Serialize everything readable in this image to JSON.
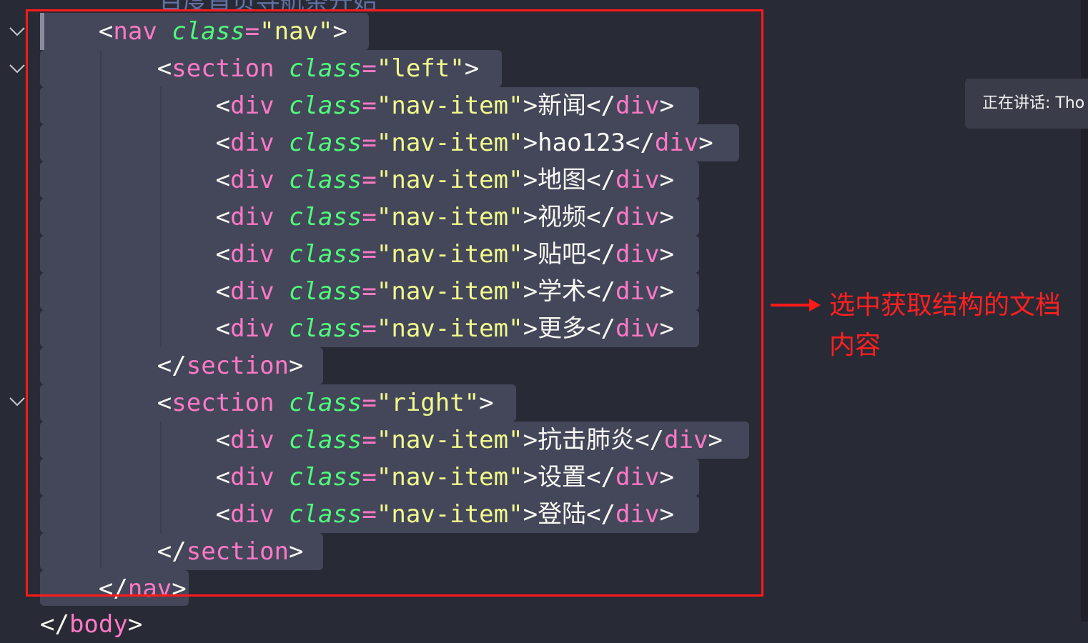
{
  "editor": {
    "top_partial_comment": "    百度首页导航条开始",
    "lines": [
      {
        "indent": "    ",
        "open": "<",
        "tag": "nav",
        "attr": "class",
        "eq": "=",
        "val": "\"nav\"",
        "close": ">",
        "text": "",
        "end_open": "",
        "end_tag": "",
        "end_close": ""
      },
      {
        "indent": "        ",
        "open": "<",
        "tag": "section",
        "attr": "class",
        "eq": "=",
        "val": "\"left\"",
        "close": ">",
        "text": "",
        "end_open": "",
        "end_tag": "",
        "end_close": ""
      },
      {
        "indent": "            ",
        "open": "<",
        "tag": "div",
        "attr": "class",
        "eq": "=",
        "val": "\"nav-item\"",
        "close": ">",
        "text": "新闻",
        "end_open": "</",
        "end_tag": "div",
        "end_close": ">"
      },
      {
        "indent": "            ",
        "open": "<",
        "tag": "div",
        "attr": "class",
        "eq": "=",
        "val": "\"nav-item\"",
        "close": ">",
        "text": "hao123",
        "end_open": "</",
        "end_tag": "div",
        "end_close": ">"
      },
      {
        "indent": "            ",
        "open": "<",
        "tag": "div",
        "attr": "class",
        "eq": "=",
        "val": "\"nav-item\"",
        "close": ">",
        "text": "地图",
        "end_open": "</",
        "end_tag": "div",
        "end_close": ">"
      },
      {
        "indent": "            ",
        "open": "<",
        "tag": "div",
        "attr": "class",
        "eq": "=",
        "val": "\"nav-item\"",
        "close": ">",
        "text": "视频",
        "end_open": "</",
        "end_tag": "div",
        "end_close": ">"
      },
      {
        "indent": "            ",
        "open": "<",
        "tag": "div",
        "attr": "class",
        "eq": "=",
        "val": "\"nav-item\"",
        "close": ">",
        "text": "贴吧",
        "end_open": "</",
        "end_tag": "div",
        "end_close": ">"
      },
      {
        "indent": "            ",
        "open": "<",
        "tag": "div",
        "attr": "class",
        "eq": "=",
        "val": "\"nav-item\"",
        "close": ">",
        "text": "学术",
        "end_open": "</",
        "end_tag": "div",
        "end_close": ">"
      },
      {
        "indent": "            ",
        "open": "<",
        "tag": "div",
        "attr": "class",
        "eq": "=",
        "val": "\"nav-item\"",
        "close": ">",
        "text": "更多",
        "end_open": "</",
        "end_tag": "div",
        "end_close": ">"
      },
      {
        "indent": "        ",
        "open": "</",
        "tag": "section",
        "attr": "",
        "eq": "",
        "val": "",
        "close": ">",
        "text": "",
        "end_open": "",
        "end_tag": "",
        "end_close": ""
      },
      {
        "indent": "        ",
        "open": "<",
        "tag": "section",
        "attr": "class",
        "eq": "=",
        "val": "\"right\"",
        "close": ">",
        "text": "",
        "end_open": "",
        "end_tag": "",
        "end_close": ""
      },
      {
        "indent": "            ",
        "open": "<",
        "tag": "div",
        "attr": "class",
        "eq": "=",
        "val": "\"nav-item\"",
        "close": ">",
        "text": "抗击肺炎",
        "end_open": "</",
        "end_tag": "div",
        "end_close": ">"
      },
      {
        "indent": "            ",
        "open": "<",
        "tag": "div",
        "attr": "class",
        "eq": "=",
        "val": "\"nav-item\"",
        "close": ">",
        "text": "设置",
        "end_open": "</",
        "end_tag": "div",
        "end_close": ">"
      },
      {
        "indent": "            ",
        "open": "<",
        "tag": "div",
        "attr": "class",
        "eq": "=",
        "val": "\"nav-item\"",
        "close": ">",
        "text": "登陆",
        "end_open": "</",
        "end_tag": "div",
        "end_close": ">"
      },
      {
        "indent": "        ",
        "open": "</",
        "tag": "section",
        "attr": "",
        "eq": "",
        "val": "",
        "close": ">",
        "text": "",
        "end_open": "",
        "end_tag": "",
        "end_close": ""
      },
      {
        "indent": "    ",
        "open": "</",
        "tag": "nav",
        "attr": "",
        "eq": "",
        "val": "",
        "close": ">",
        "text": "",
        "end_open": "",
        "end_tag": "",
        "end_close": ""
      }
    ],
    "bottom_partial": {
      "open": "</",
      "tag": "body",
      "close": ">"
    }
  },
  "annotation": {
    "text": "选中获取结构的文档内容",
    "color": "#ff2020"
  },
  "tooltip": {
    "text": "正在讲话: Tho"
  },
  "colors": {
    "background": "#282a36",
    "selection": "#44475a",
    "tag": "#ff79c6",
    "attr": "#50fa7b",
    "string": "#f1fa8c",
    "annotation_red": "#ff1a1a"
  },
  "icons": {
    "fold": "chevron-down-icon",
    "arrow": "arrow-right-icon"
  }
}
